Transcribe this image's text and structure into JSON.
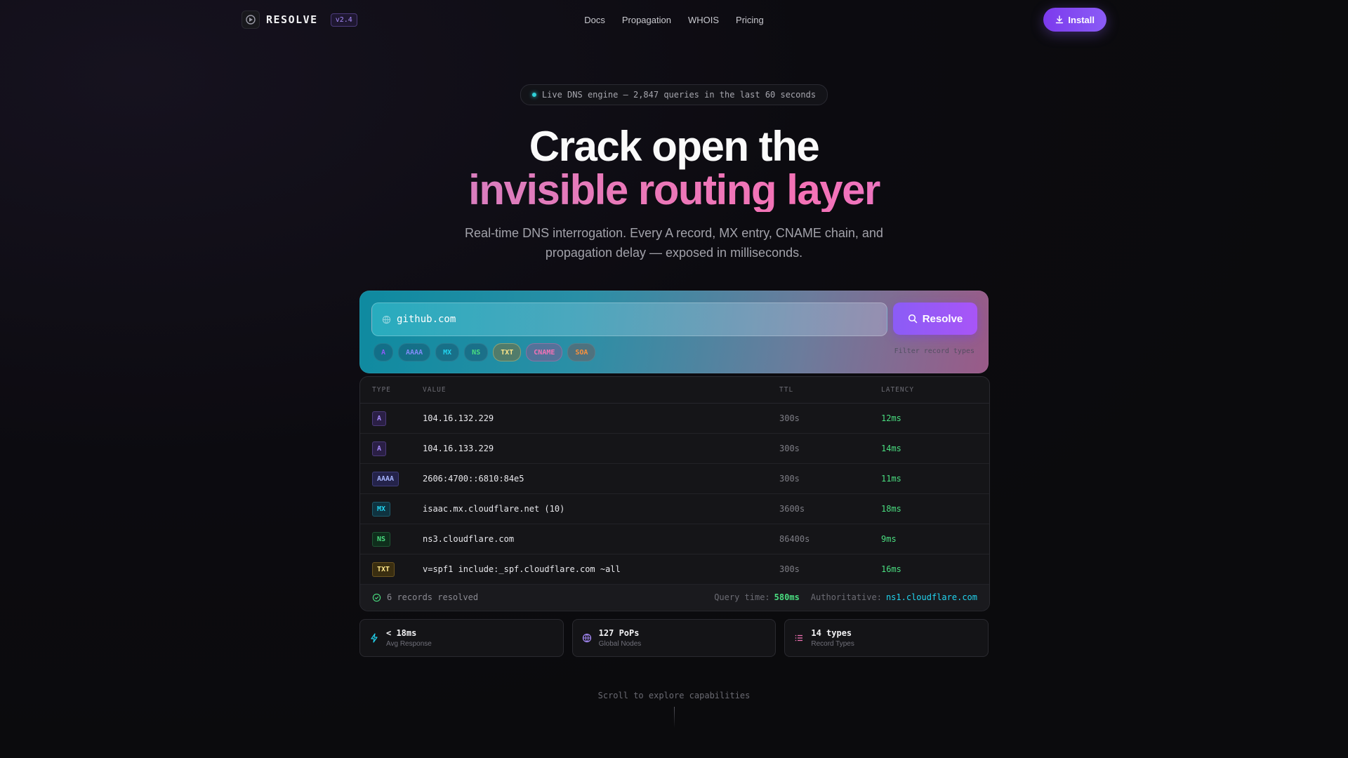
{
  "nav": {
    "brand": "RESOLVE",
    "version": "v2.4",
    "links": [
      "Docs",
      "Propagation",
      "WHOIS",
      "Pricing"
    ],
    "install_label": "Install"
  },
  "hero": {
    "pill": "Live DNS engine — 2,847 queries in the last 60 seconds",
    "title_line1": "Crack open the",
    "title_line2": "invisible routing layer",
    "subtitle_line1": "Real-time DNS interrogation. Every A record, MX entry, CNAME chain, and",
    "subtitle_line2": "propagation delay — exposed in milliseconds."
  },
  "search": {
    "value": "github.com",
    "button": "Resolve",
    "filter_label": "Filter record types",
    "chips": [
      {
        "label": "A",
        "color": "#8b5cf6"
      },
      {
        "label": "AAAA",
        "color": "#818cf8"
      },
      {
        "label": "MX",
        "color": "#22d3ee"
      },
      {
        "label": "NS",
        "color": "#4ade80"
      },
      {
        "label": "TXT",
        "color": "#fde68a"
      },
      {
        "label": "CNAME",
        "color": "#f472b6"
      },
      {
        "label": "SOA",
        "color": "#fb923c"
      }
    ]
  },
  "table": {
    "headers": [
      "TYPE",
      "VALUE",
      "TTL",
      "LATENCY"
    ],
    "rows": [
      {
        "type": "A",
        "value": "104.16.132.229",
        "ttl": "300s",
        "latency": "12ms",
        "fg": "#a78bfa",
        "bg": "#2a1f45",
        "bd": "#4c3a7a"
      },
      {
        "type": "A",
        "value": "104.16.133.229",
        "ttl": "300s",
        "latency": "14ms",
        "fg": "#a78bfa",
        "bg": "#2a1f45",
        "bd": "#4c3a7a"
      },
      {
        "type": "AAAA",
        "value": "2606:4700::6810:84e5",
        "ttl": "300s",
        "latency": "11ms",
        "fg": "#a5b4fc",
        "bg": "#24234a",
        "bd": "#3f3d7a"
      },
      {
        "type": "MX",
        "value": "isaac.mx.cloudflare.net (10)",
        "ttl": "3600s",
        "latency": "18ms",
        "fg": "#22d3ee",
        "bg": "#0f3340",
        "bd": "#1d5a6a"
      },
      {
        "type": "NS",
        "value": "ns3.cloudflare.com",
        "ttl": "86400s",
        "latency": "9ms",
        "fg": "#4ade80",
        "bg": "#0f2e1c",
        "bd": "#1e5533"
      },
      {
        "type": "TXT",
        "value": "v=spf1 include:_spf.cloudflare.com ~all",
        "ttl": "300s",
        "latency": "16ms",
        "fg": "#fde68a",
        "bg": "#3a2e10",
        "bd": "#6b5420"
      }
    ],
    "footer": {
      "resolved": "6 records resolved",
      "query_label": "Query time:",
      "query_value": "580ms",
      "auth_label": "Authoritative:",
      "auth_value": "ns1.cloudflare.com"
    }
  },
  "stats": [
    {
      "value": "< 18ms",
      "label": "Avg Response",
      "icon": "bolt-icon"
    },
    {
      "value": "127 PoPs",
      "label": "Global Nodes",
      "icon": "globe-icon"
    },
    {
      "value": "14 types",
      "label": "Record Types",
      "icon": "list-icon"
    }
  ],
  "scroll_hint": "Scroll to explore capabilities"
}
